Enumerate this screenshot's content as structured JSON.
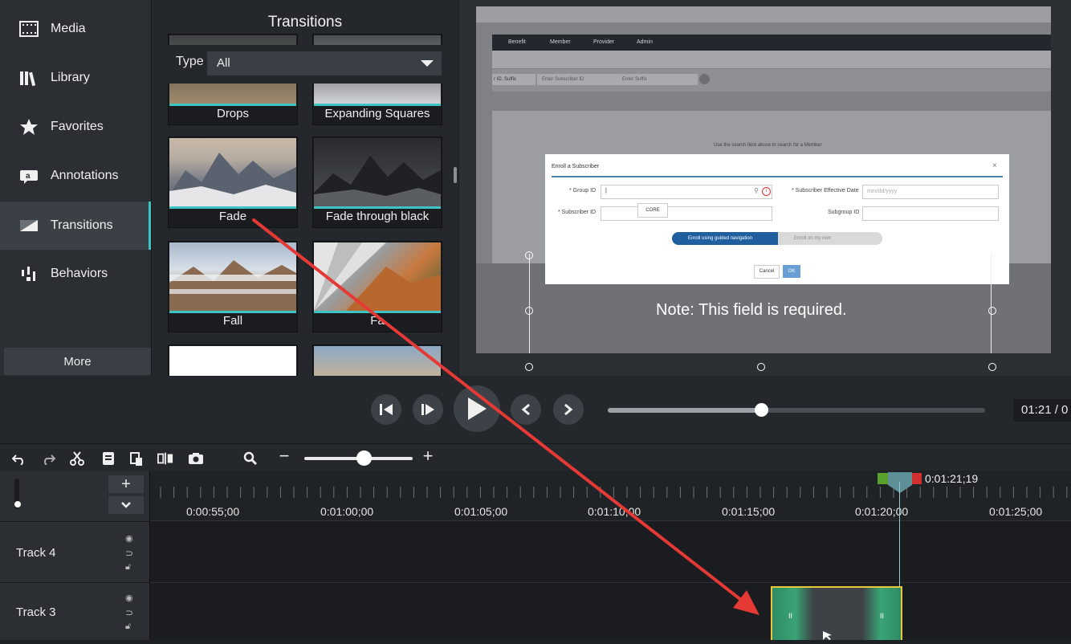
{
  "sidebar": {
    "items": [
      {
        "label": "Media",
        "icon": "film-icon"
      },
      {
        "label": "Library",
        "icon": "library-icon"
      },
      {
        "label": "Favorites",
        "icon": "star-icon"
      },
      {
        "label": "Annotations",
        "icon": "annotation-icon"
      },
      {
        "label": "Transitions",
        "icon": "transition-icon",
        "active": true
      },
      {
        "label": "Behaviors",
        "icon": "behaviors-icon"
      }
    ],
    "more_label": "More"
  },
  "panel": {
    "title": "Transitions",
    "type_label": "Type",
    "type_value": "All",
    "tiles": [
      {
        "label": "Drops"
      },
      {
        "label": "Expanding Squares"
      },
      {
        "label": "Fade"
      },
      {
        "label": "Fade through black"
      },
      {
        "label": "Fall"
      },
      {
        "label": "Fa"
      },
      {
        "label": ""
      },
      {
        "label": ""
      }
    ]
  },
  "preview": {
    "app_nav": [
      "Benefit",
      "Member",
      "Provider",
      "Admin"
    ],
    "search": {
      "suffix_select": "r ID, Suffix",
      "subscriber_placeholder": "Enter Subscriber ID",
      "suffix_placeholder": "Enter Suffix"
    },
    "hint_text": "Use the search field above to search for a Member",
    "dialog": {
      "title": "Enroll a Subscriber",
      "close": "×",
      "group_id_label": "* Group ID",
      "group_id_value": "|",
      "subscriber_effective_label": "* Subscriber Effective Date",
      "date_placeholder": "mm/dd/yyyy",
      "subscriber_id_label": "* Subscriber ID",
      "core_text": "CORE",
      "subgroup_label": "Subgroup ID",
      "guided_label": "Enroll using guided navigation",
      "own_label": "Enroll on my own",
      "cancel": "Cancel",
      "ok": "OK"
    },
    "note": "Note: This field is required."
  },
  "transport": {
    "time": "01:21 / 0",
    "progress": 0.41
  },
  "toolbar": {
    "minus": "−",
    "plus": "+",
    "zoom_level": 0.56
  },
  "timeline": {
    "ruler_labels": [
      "0:00:55;00",
      "0:01:00;00",
      "0:01:05;00",
      "0:01:10;00",
      "0:01:15;00",
      "0:01:20;00",
      "0:01:25;00"
    ],
    "playhead_time": "0:01:21;19",
    "tracks": [
      {
        "name": "Track 4"
      },
      {
        "name": "Track 3"
      }
    ],
    "add_track": "+",
    "collapse": "⌄"
  },
  "colors": {
    "accent": "#3dc4c4",
    "annotation_arrow": "#e53935",
    "clip_border": "#e8c83a",
    "clip_green": "#3aa475"
  }
}
